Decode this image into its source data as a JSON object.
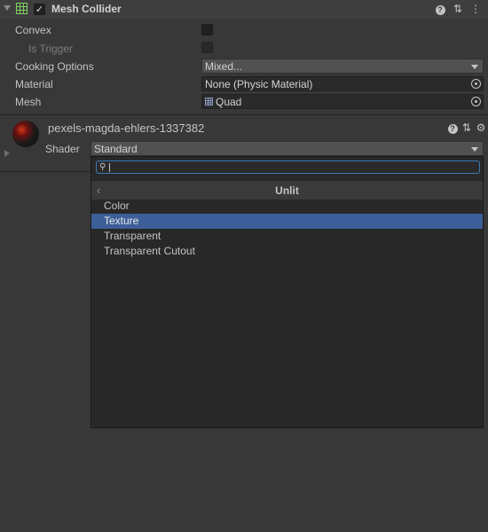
{
  "component": {
    "title": "Mesh Collider",
    "enabled": true,
    "icons": [
      "collapse-arrow-icon",
      "mesh-grid-icon",
      "help-icon",
      "preset-sliders-icon",
      "more-menu-icon"
    ]
  },
  "properties": [
    {
      "label": "Convex",
      "type": "checkbox",
      "checked": false
    },
    {
      "label": "Is Trigger",
      "type": "checkbox",
      "checked": false,
      "disabled": true
    },
    {
      "label": "Cooking Options",
      "type": "dropdown",
      "value": "Mixed..."
    },
    {
      "label": "Material",
      "type": "object",
      "value": "None (Physic Material)"
    },
    {
      "label": "Mesh",
      "type": "object",
      "value": "Quad"
    }
  ],
  "material": {
    "name": "pexels-magda-ehlers-1337382",
    "shader_label": "Shader",
    "shader_value": "Standard"
  },
  "shader_popup": {
    "search_value": "",
    "category": "Unlit",
    "items": [
      "Color",
      "Texture",
      "Transparent",
      "Transparent Cutout"
    ],
    "selected_index": 1
  },
  "colors": {
    "background": "#383838",
    "selection": "#3d5f99",
    "search_focus": "#3a79bb"
  }
}
